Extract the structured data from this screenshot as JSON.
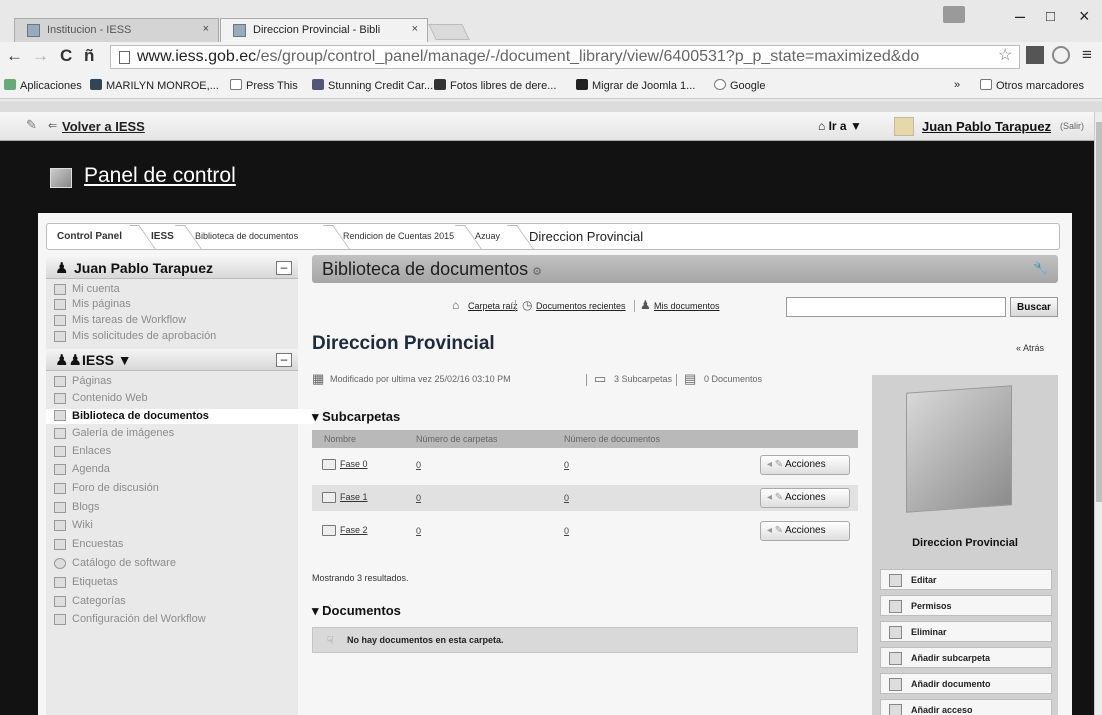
{
  "browser": {
    "tabs": [
      {
        "label": "Institucion - IESS"
      },
      {
        "label": "Direccion Provincial - Bibli"
      }
    ],
    "tab_close": "×",
    "window_controls": {
      "minimize": "–",
      "maximize": "□",
      "close": "×"
    },
    "nav": {
      "back": "←",
      "forward": "→",
      "reload": "C",
      "home": "ñ"
    },
    "url_host": "www.iess.gob.ec",
    "url_path": "/es/group/control_panel/manage/-/document_library/view/6400531?p_p_state=maximized&do",
    "bookmarks": [
      {
        "label": "Aplicaciones",
        "icon": "apps-grid-icon"
      },
      {
        "label": "MARILYN MONROE,...",
        "icon": "bookmark-icon"
      },
      {
        "label": "Press This",
        "icon": "page-icon"
      },
      {
        "label": "Stunning Credit Car...",
        "icon": "bookmark-icon"
      },
      {
        "label": "Fotos libres de dere...",
        "icon": "bookmark-icon"
      },
      {
        "label": "Migrar de Joomla 1...",
        "icon": "youtube-icon"
      },
      {
        "label": "Google",
        "icon": "google-icon"
      },
      {
        "label": "»",
        "icon": ""
      },
      {
        "label": "Otros marcadores",
        "icon": "folder-icon"
      }
    ]
  },
  "dockbar": {
    "back_link": "Volver a IESS",
    "goto_label": "Ir a ▼",
    "user_name": "Juan Pablo Tarapuez",
    "signout": "(Salir)"
  },
  "panel": {
    "title": "Panel de control"
  },
  "breadcrumb": [
    {
      "label": "Control Panel"
    },
    {
      "label": "IESS"
    },
    {
      "label": "Biblioteca de documentos"
    },
    {
      "label": "Rendicion de Cuentas 2015"
    },
    {
      "label": "Azuay"
    },
    {
      "label": "Direccion Provincial"
    }
  ],
  "sidebar": {
    "user_section": {
      "title": "Juan Pablo Tarapuez",
      "items": [
        {
          "label": "Mi cuenta"
        },
        {
          "label": "Mis páginas"
        },
        {
          "label": "Mis tareas de Workflow"
        },
        {
          "label": "Mis solicitudes de aprobación"
        }
      ]
    },
    "site_section": {
      "title": "IESS ▼",
      "items": [
        {
          "label": "Páginas"
        },
        {
          "label": "Contenido Web"
        },
        {
          "label": "Biblioteca de documentos",
          "selected": true
        },
        {
          "label": "Galería de imágenes"
        },
        {
          "label": "Enlaces"
        },
        {
          "label": "Agenda"
        },
        {
          "label": "Foro de discusión"
        },
        {
          "label": "Blogs"
        },
        {
          "label": "Wiki"
        },
        {
          "label": "Encuestas"
        },
        {
          "label": "Catálogo de software"
        },
        {
          "label": "Etiquetas"
        },
        {
          "label": "Categorías"
        },
        {
          "label": "Configuración del Workflow"
        }
      ]
    },
    "minimize_label": "–"
  },
  "portlet": {
    "title": "Biblioteca de documentos",
    "top_links": {
      "root": "Carpeta raíz",
      "recent": "Documentos recientes",
      "mine": "Mis documentos"
    },
    "search_value": "",
    "search_button": "Buscar",
    "folder_title": "Direccion Provincial",
    "back": "« Atrás",
    "meta": {
      "modified": "Modificado por ultima vez 25/02/16 03:10 PM",
      "subfolders": "3 Subcarpetas",
      "documents": "0 Documentos"
    },
    "subfolders": {
      "heading": "Subcarpetas",
      "columns": [
        "Nombre",
        "Número de carpetas",
        "Número de documentos"
      ],
      "rows": [
        {
          "name": "Fase 0",
          "folders": "0",
          "documents": "0",
          "action": "Acciones"
        },
        {
          "name": "Fase 1",
          "folders": "0",
          "documents": "0",
          "action": "Acciones"
        },
        {
          "name": "Fase 2",
          "folders": "0",
          "documents": "0",
          "action": "Acciones"
        }
      ],
      "results": "Mostrando 3 resultados."
    },
    "documents": {
      "heading": "Documentos",
      "empty": "No hay documentos en esta carpeta."
    },
    "aside": {
      "title": "Direccion Provincial",
      "menu": [
        {
          "label": "Editar"
        },
        {
          "label": "Permisos"
        },
        {
          "label": "Eliminar"
        },
        {
          "label": "Añadir subcarpeta"
        },
        {
          "label": "Añadir documento"
        },
        {
          "label": "Añadir acceso"
        }
      ]
    }
  }
}
